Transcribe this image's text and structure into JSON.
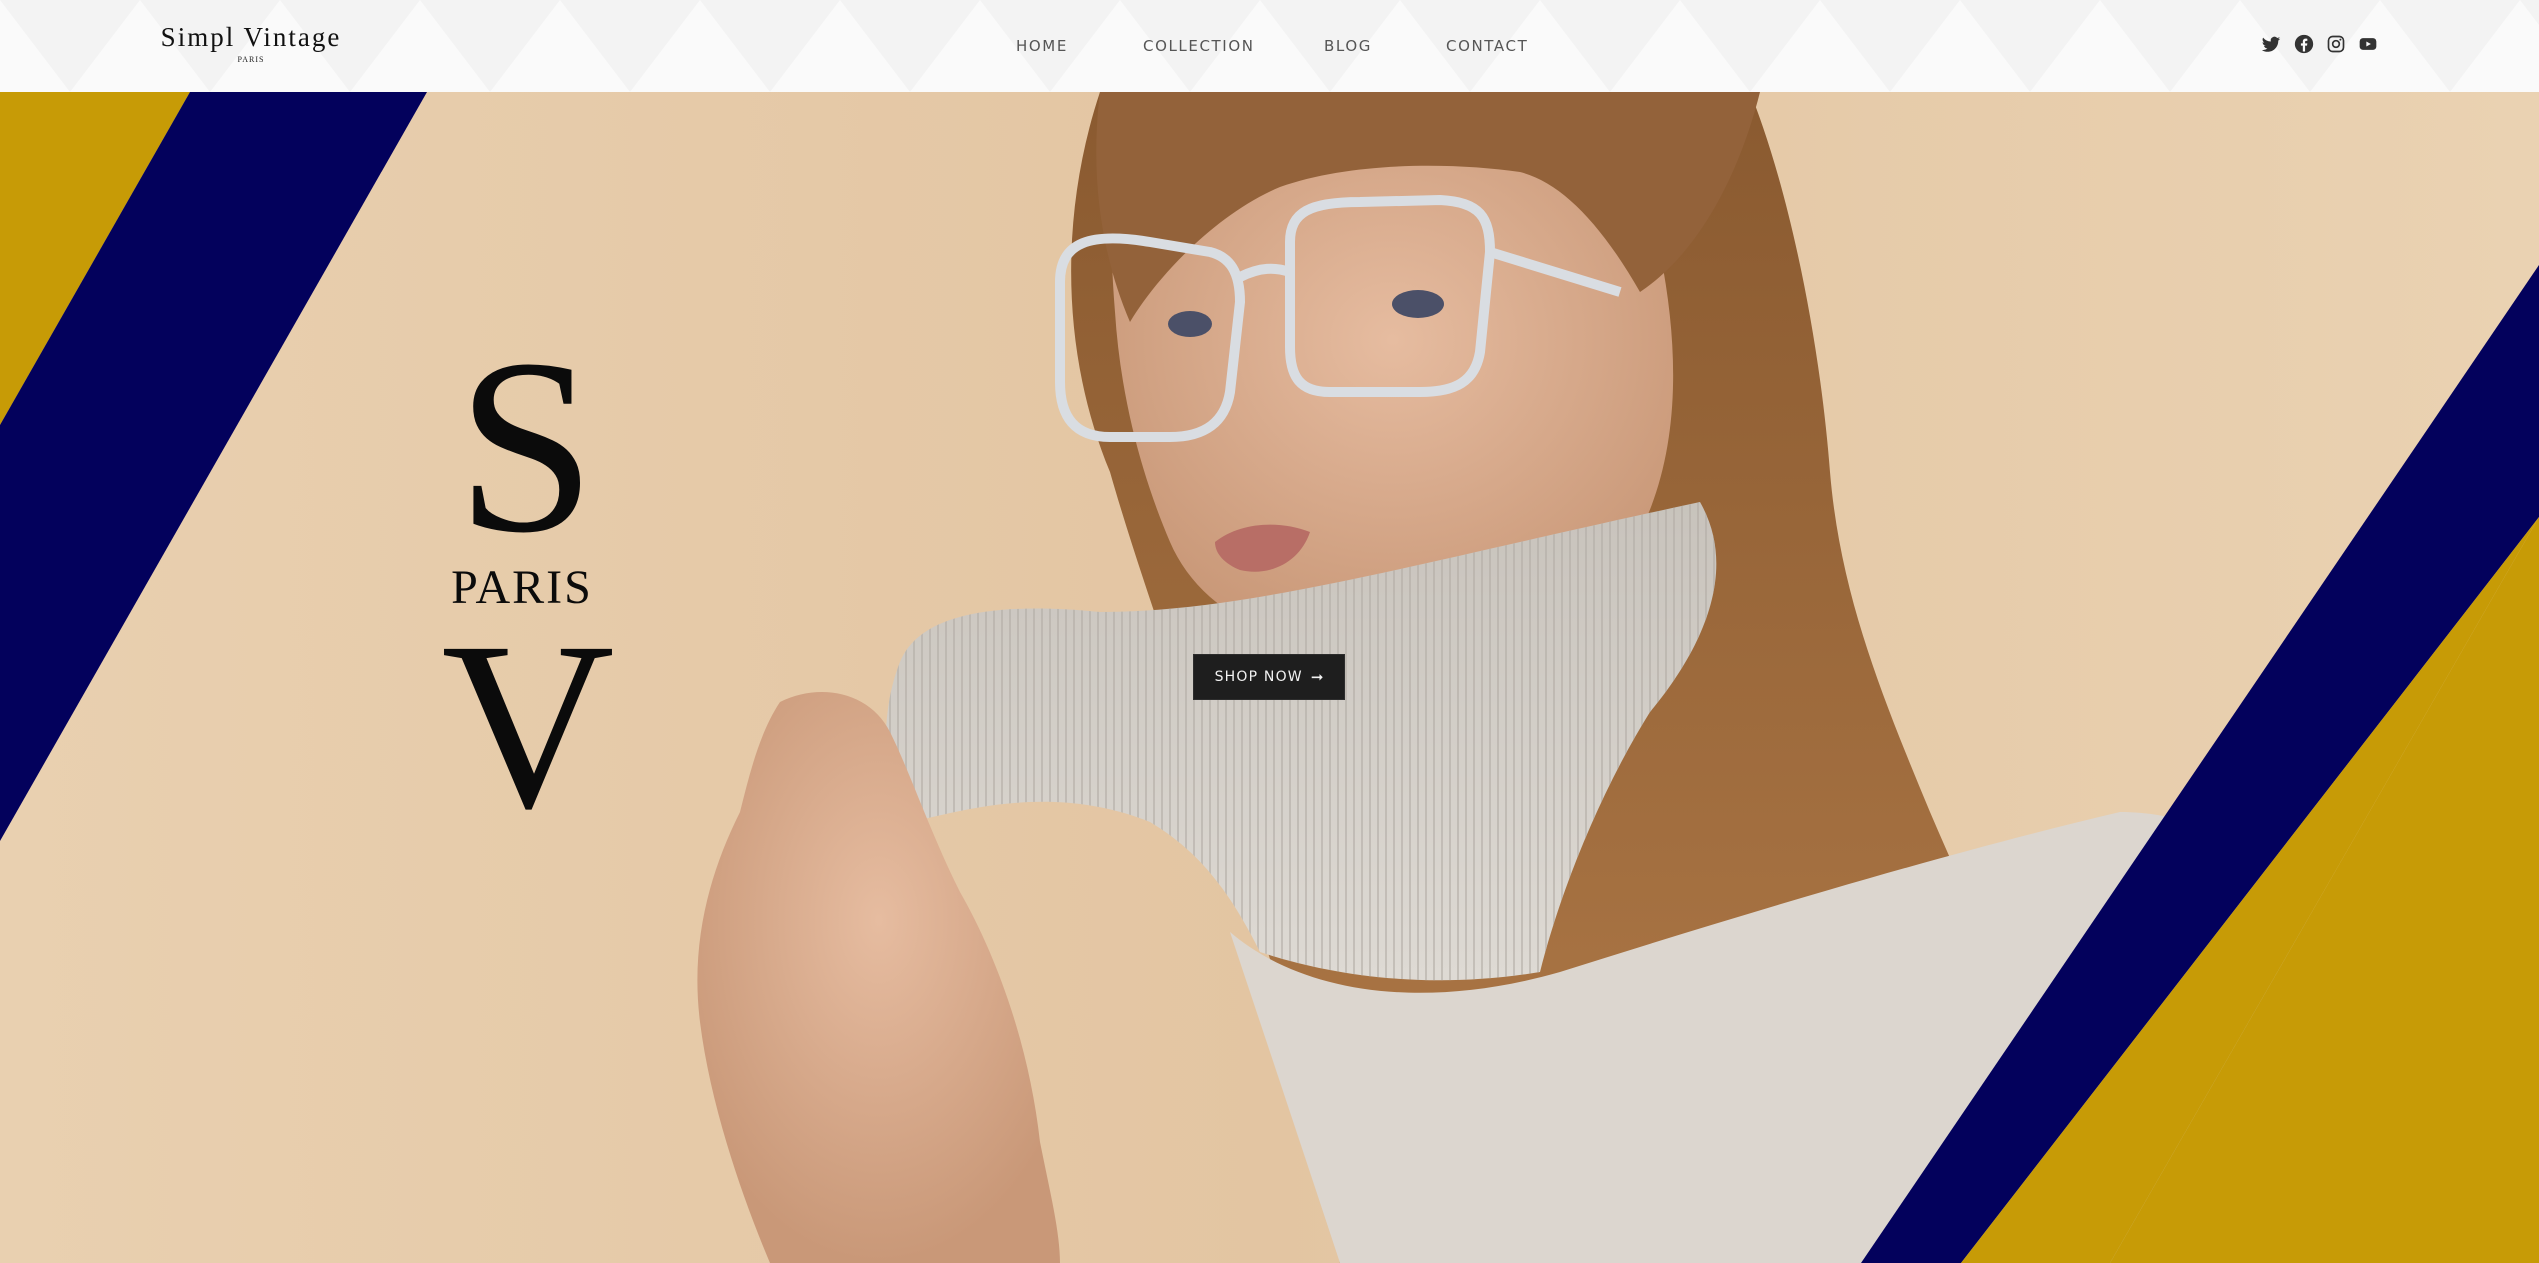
{
  "brand": {
    "name": "Simpl Vintage",
    "tagline": "PARIS"
  },
  "nav": {
    "items": [
      {
        "label": "HOME"
      },
      {
        "label": "COLLECTION"
      },
      {
        "label": "BLOG"
      },
      {
        "label": "CONTACT"
      }
    ]
  },
  "social": {
    "icons": [
      "twitter-icon",
      "facebook-icon",
      "instagram-icon",
      "youtube-icon"
    ]
  },
  "hero": {
    "monogram": {
      "top_letter": "S",
      "middle": "PARIS",
      "bottom_letter": "V"
    },
    "cta": {
      "label": "SHOP NOW",
      "arrow": "➞"
    }
  },
  "colors": {
    "stripe_gold": "#c79b06",
    "stripe_navy": "#03015c",
    "background_beige": "#e8cfae",
    "button_dark": "#1e1e1e"
  }
}
